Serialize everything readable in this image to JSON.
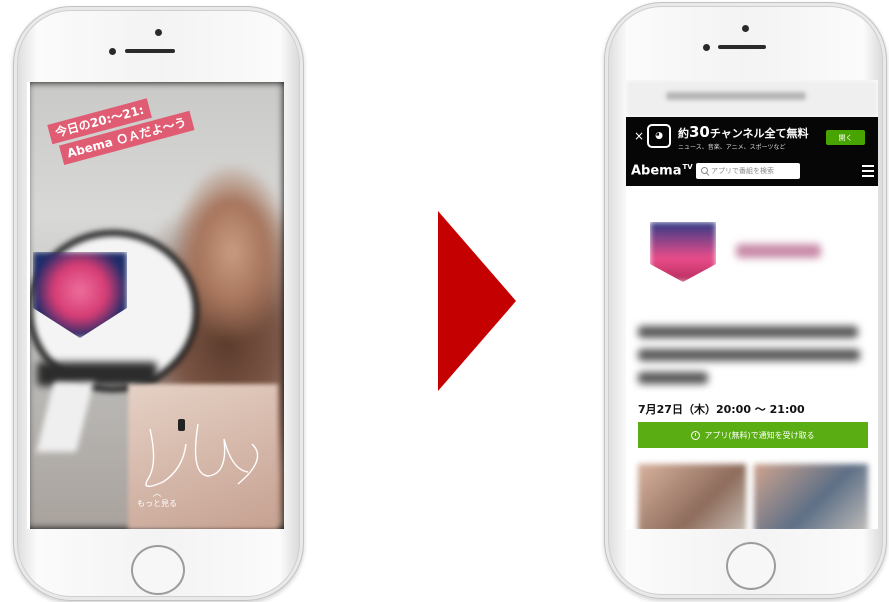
{
  "left_phone": {
    "sticker_line1": "今日の20:〜21:",
    "sticker_line2": "Abema ＯＡだよ〜う",
    "more_label": "もっと見る",
    "chevron": "︿"
  },
  "arrow_color": "#c40000",
  "right_phone": {
    "banner": {
      "close": "×",
      "headline_prefix": "約",
      "headline_number": "30",
      "headline_suffix": "チャンネル全て無料",
      "subtext": "ニュース、音楽、アニメ、スポーツなど",
      "open_button": "開く"
    },
    "nav": {
      "brand": "Abema",
      "brand_sup": "TV",
      "search_placeholder": "アプリで番組を検索"
    },
    "program": {
      "date_time": "7月27日（木）20:00 〜 21:00",
      "notify_button": "アプリ(無料)で通知を受け取る"
    },
    "colors": {
      "banner_bg": "#060606",
      "open_button_bg": "#48a400",
      "notify_button_bg": "#5aae14"
    }
  }
}
